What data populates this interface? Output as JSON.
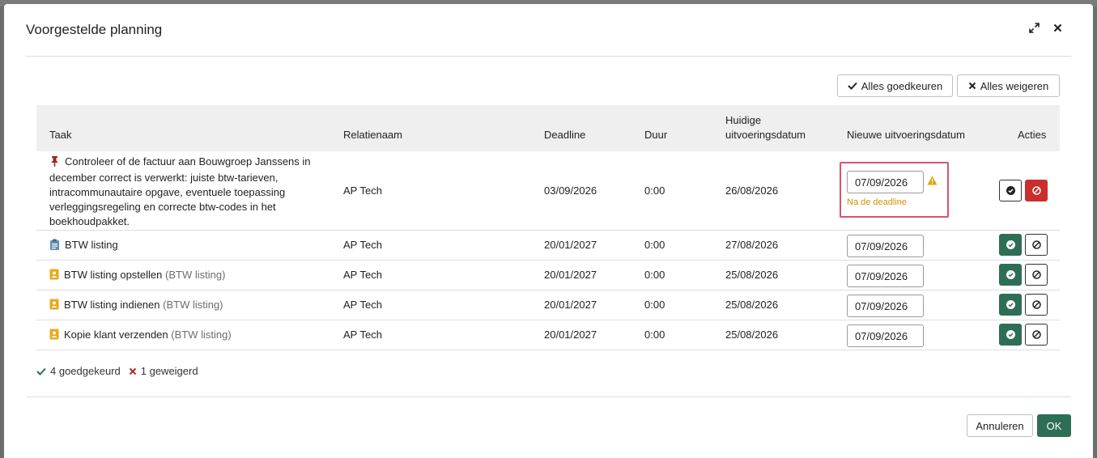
{
  "dialog": {
    "title": "Voorgestelde planning",
    "approve_all": "Alles goedkeuren",
    "reject_all": "Alles weigeren",
    "cancel": "Annuleren",
    "ok": "OK"
  },
  "table": {
    "headers": {
      "task": "Taak",
      "relation": "Relatienaam",
      "deadline": "Deadline",
      "duration": "Duur",
      "current_line1": "Huidige",
      "current_line2": "uitvoeringsdatum",
      "new_date": "Nieuwe uitvoeringsdatum",
      "actions": "Acties"
    },
    "rows": [
      {
        "task": "Controleer of de factuur aan Bouwgroep Janssens in december correct is verwerkt: juiste btw-tarieven, intracommunautaire opgave, eventuele toepassing verleggingsregeling en correcte btw-codes in het boekhoudpakket.",
        "sub": "",
        "icon": "pin-icon",
        "relation": "AP Tech",
        "deadline": "03/09/2026",
        "duration": "0:00",
        "current": "26/08/2026",
        "new_date": "07/09/2026",
        "warning": "Na de deadline",
        "status": "rejected"
      },
      {
        "task": "BTW listing",
        "sub": "",
        "icon": "clipboard-icon",
        "relation": "AP Tech",
        "deadline": "20/01/2027",
        "duration": "0:00",
        "current": "27/08/2026",
        "new_date": "07/09/2026",
        "status": "approved"
      },
      {
        "task": "BTW listing opstellen",
        "sub": "(BTW listing)",
        "icon": "person-badge-icon",
        "relation": "AP Tech",
        "deadline": "20/01/2027",
        "duration": "0:00",
        "current": "25/08/2026",
        "new_date": "07/09/2026",
        "status": "approved"
      },
      {
        "task": "BTW listing indienen",
        "sub": "(BTW listing)",
        "icon": "person-badge-icon",
        "relation": "AP Tech",
        "deadline": "20/01/2027",
        "duration": "0:00",
        "current": "25/08/2026",
        "new_date": "07/09/2026",
        "status": "approved"
      },
      {
        "task": "Kopie klant verzenden",
        "sub": "(BTW listing)",
        "icon": "person-badge-icon",
        "relation": "AP Tech",
        "deadline": "20/01/2027",
        "duration": "0:00",
        "current": "25/08/2026",
        "new_date": "07/09/2026",
        "status": "approved"
      }
    ]
  },
  "summary": {
    "approved": "4 goedgekeurd",
    "rejected": "1 geweigerd"
  },
  "colors": {
    "approve_green": "#2e6e55",
    "reject_red": "#cc2d2d",
    "warning_orange": "#d49000",
    "highlight_pink": "#d7546f"
  }
}
